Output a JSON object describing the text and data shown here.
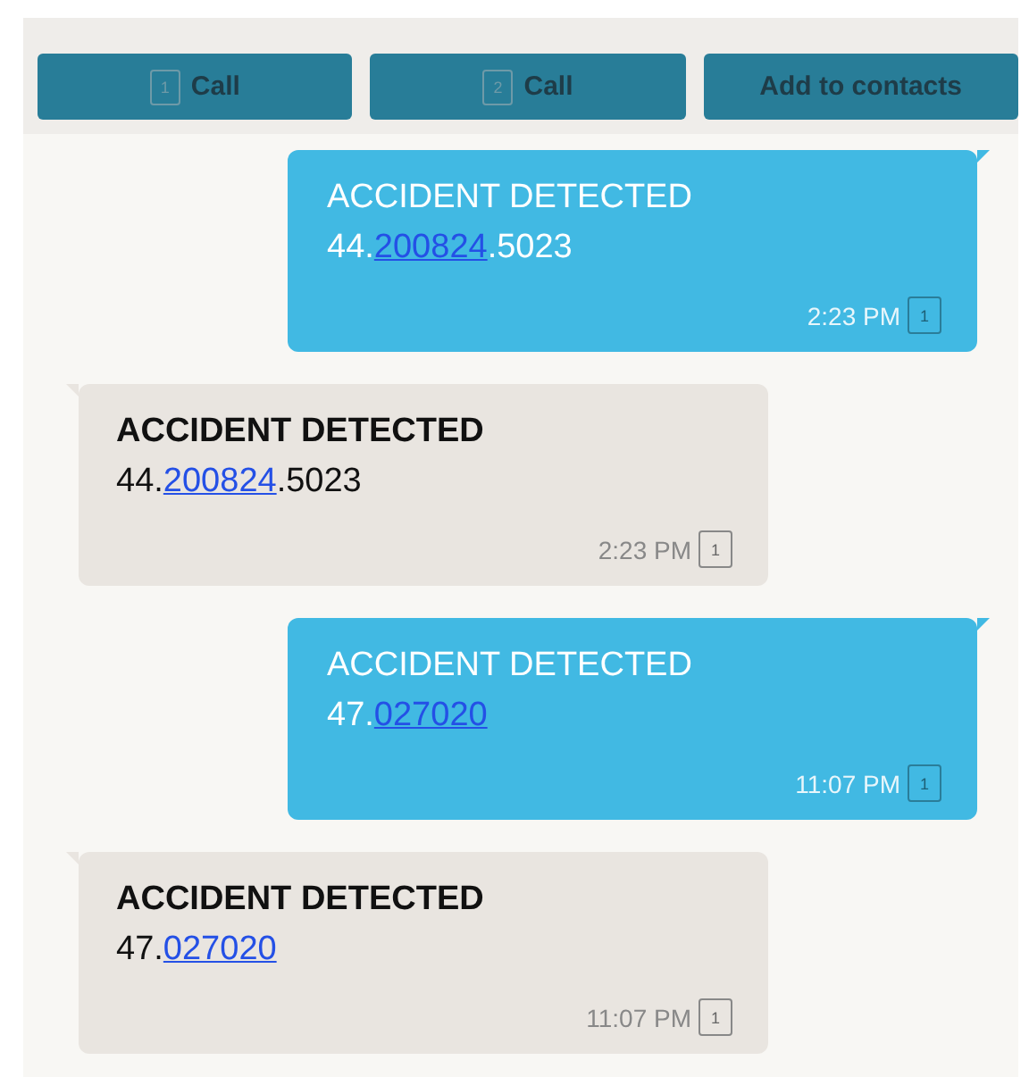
{
  "actions": [
    {
      "kind": "sim-call",
      "label": "Call",
      "sim": "1"
    },
    {
      "kind": "sim-call",
      "label": "Call",
      "sim": "2"
    },
    {
      "kind": "plain",
      "label": "Add to contacts"
    }
  ],
  "messages": [
    {
      "kind": "sent",
      "title": "ACCIDENT DETECTED",
      "body": [
        {
          "text": "44.",
          "link": false
        },
        {
          "text": "200824",
          "link": true
        },
        {
          "text": ".5023",
          "link": false
        }
      ],
      "time": "2:23 PM",
      "sim": "1"
    },
    {
      "kind": "received",
      "title": "ACCIDENT DETECTED",
      "body": [
        {
          "text": "44.",
          "link": false
        },
        {
          "text": "200824",
          "link": true
        },
        {
          "text": ".5023",
          "link": false
        }
      ],
      "time": "2:23 PM",
      "sim": "1"
    },
    {
      "kind": "sent",
      "title": "ACCIDENT DETECTED",
      "body": [
        {
          "text": "47.",
          "link": false
        },
        {
          "text": "027020",
          "link": true
        }
      ],
      "time": "11:07 PM",
      "sim": "1"
    },
    {
      "kind": "received",
      "title": "ACCIDENT DETECTED",
      "body": [
        {
          "text": "47.",
          "link": false
        },
        {
          "text": "027020",
          "link": true
        }
      ],
      "time": "11:07 PM",
      "sim": "1"
    }
  ]
}
